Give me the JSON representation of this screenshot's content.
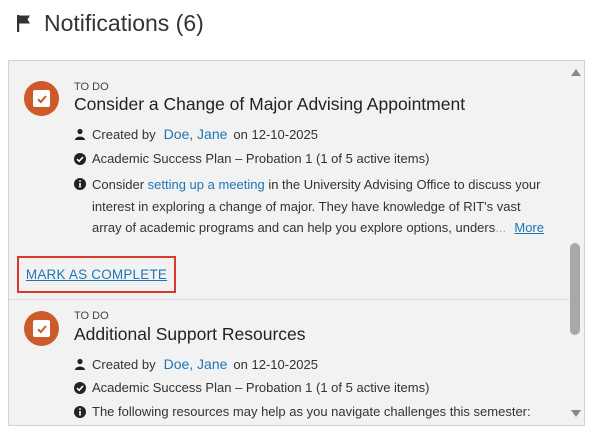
{
  "header": {
    "title": "Notifications (6)",
    "icon": "flag-icon"
  },
  "colors": {
    "accent": "#cc5a2a",
    "link": "#1f75b5",
    "highlight": "#d93a2a"
  },
  "notifications": [
    {
      "kind": "TO DO",
      "title": "Consider a Change of Major Advising Appointment",
      "created_prefix": "Created by",
      "created_by": "Doe, Jane",
      "created_on": "on 12-10-2025",
      "plan": "Academic Success Plan – Probation 1 (1 of 5 active items)",
      "body_pre": "Consider ",
      "body_link": "setting up a meeting",
      "body_post": " in the University Advising Office to discuss your",
      "body_line2": "interest in exploring a change of major. They have knowledge of RIT's vast",
      "body_line3": "array of academic programs and can help you explore options, unders",
      "body_line3_fade": "...",
      "more": "More",
      "action": "MARK AS COMPLETE"
    },
    {
      "kind": "TO DO",
      "title": "Additional Support Resources",
      "created_prefix": "Created by",
      "created_by": "Doe, Jane",
      "created_on": "on 12-10-2025",
      "plan": "Academic Success Plan – Probation 1 (1 of 5 active items)",
      "body": "The following resources may help as you navigate challenges this semester:"
    }
  ]
}
